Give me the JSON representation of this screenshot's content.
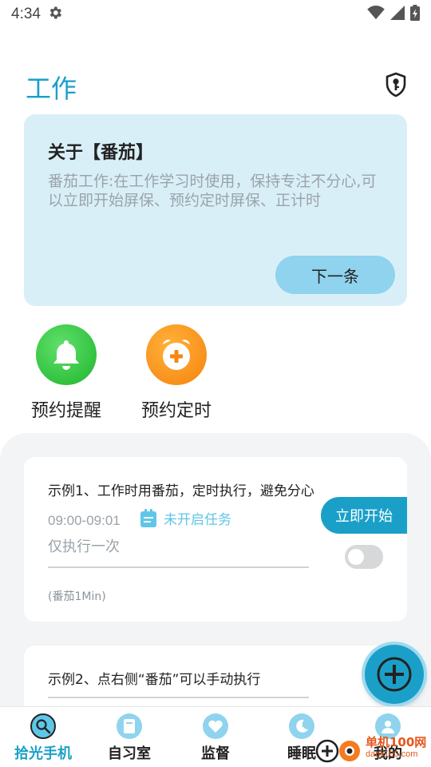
{
  "status_bar": {
    "time": "4:34"
  },
  "page": {
    "title": "工作"
  },
  "info_card": {
    "title": "关于【番茄】",
    "text": "番茄工作:在工作学习时使用，保持专注不分心,可以立即开始屏保、预约定时屏保、正计时",
    "next_label": "下一条"
  },
  "quick_actions": [
    {
      "label": "预约提醒",
      "icon": "bell-icon",
      "color": "#22b830"
    },
    {
      "label": "预约定时",
      "icon": "alarm-clock-icon",
      "color": "#f5880f"
    }
  ],
  "tasks": [
    {
      "title": "示例1、工作时用番茄，定时执行，避免分心",
      "time": "09:00-09:01",
      "status": "未开启任务",
      "repeat": "仅执行一次",
      "note": "(番茄1Min)",
      "start_label": "立即开始",
      "enabled": false
    },
    {
      "title": "示例2、点右侧“番茄”可以手动执行"
    }
  ],
  "bottom_nav": [
    {
      "label": "拾光手机",
      "icon": "magnifier-icon",
      "active": true
    },
    {
      "label": "自习室",
      "icon": "book-icon",
      "active": false
    },
    {
      "label": "监督",
      "icon": "heart-icon",
      "active": false
    },
    {
      "label": "睡眠",
      "icon": "moon-icon",
      "active": false
    },
    {
      "label": "我的",
      "icon": "user-icon",
      "active": false
    }
  ],
  "watermark": {
    "text": "单机100网",
    "url": "danji100.com"
  },
  "colors": {
    "accent": "#1aa0c8",
    "card_bg": "#d9eff8",
    "status_blue": "#5fc6e8"
  }
}
